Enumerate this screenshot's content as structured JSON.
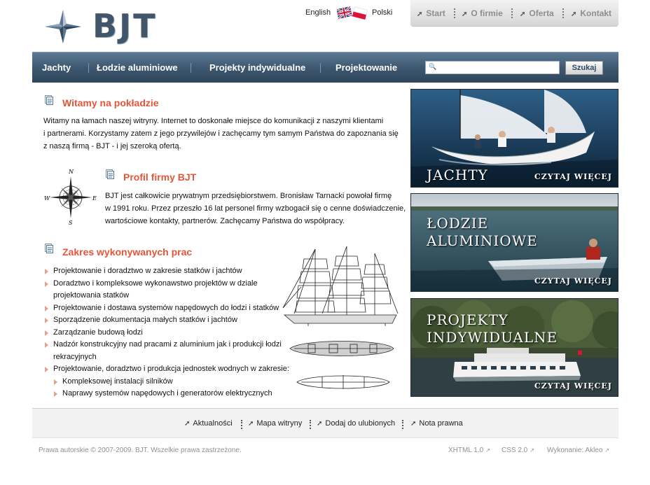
{
  "header": {
    "logo_text": "BJT",
    "lang_english": "English",
    "lang_polish": "Polski",
    "top_links": [
      "Start",
      "O firmie",
      "Oferta",
      "Kontakt"
    ]
  },
  "mainnav": {
    "items": [
      "Jachty",
      "Łodzie aluminiowe",
      "Projekty indywidualne",
      "Projektowanie"
    ],
    "search_placeholder": "",
    "search_button": "Szukaj"
  },
  "welcome": {
    "heading": "Witamy na pokładzie",
    "lines": [
      "Witamy na łamach naszej witryny. Internet to doskonałe miejsce do komunikacji z naszymi klientami",
      "i partnerami. Korzystamy zatem z jego przywilejów i zachęcamy tym samym Państwa do zapoznania się",
      "z naszą firmą - BJT - i jej szeroką ofertą."
    ]
  },
  "profile": {
    "heading": "Profil firmy BJT",
    "compass_letters": [
      "N",
      "E",
      "S",
      "W"
    ],
    "lines": [
      "BJT jest całkowicie prywatnym przedsiębiorstwem. Bronisław Tarnacki powołał firmę",
      "w 1991 roku. Przez przeszło 16 lat personel firmy wzbogacił się o cenne doświadczenie,",
      "wartościowe kontakty, partnerów. Zachęcamy Państwa do współpracy."
    ]
  },
  "scope": {
    "heading": "Zakres wykonywanych prac",
    "items": [
      {
        "text": "Projektowanie i doradztwo w zakresie statków i jachtów",
        "sub": false
      },
      {
        "text": "Doradztwo i kompleksowe wykonawstwo projektów w dziale",
        "sub": false
      },
      {
        "text": "projektowania statków",
        "sub": false,
        "cont": true
      },
      {
        "text": "Projektowanie i dostawa systemów napędowych do łodzi i statków",
        "sub": false
      },
      {
        "text": "Sporządzenie dokumentacja małych statków i jachtów",
        "sub": false
      },
      {
        "text": "Zarządzanie budową łodzi",
        "sub": false
      },
      {
        "text": "Nadzór konstrukcyjny nad pracami z aluminium jak i produkcji łodzi",
        "sub": false
      },
      {
        "text": "rekracyjnych",
        "sub": false,
        "cont": true
      },
      {
        "text": "Projektowanie, doradztwo i produkcja jednostek wodnych w zakresie:",
        "sub": false
      },
      {
        "text": "Kompleksowej instalacji silników",
        "sub": true
      },
      {
        "text": "Naprawy systemów napędowych i generatorów elektrycznych",
        "sub": true
      }
    ]
  },
  "banners": [
    {
      "title_lines": [
        "JACHTY"
      ],
      "more": "CZYTAJ WIĘCEJ"
    },
    {
      "title_lines": [
        "ŁODZIE",
        "ALUMINIOWE"
      ],
      "more": "CZYTAJ WIĘCEJ"
    },
    {
      "title_lines": [
        "PROJEKTY",
        "INDYWIDUALNE"
      ],
      "more": "CZYTAJ WIĘCEJ"
    }
  ],
  "footer": {
    "links": [
      "Aktualności",
      "Mapa witryny",
      "Dodaj do ulubionych",
      "Nota prawna"
    ],
    "copyright": "Prawa autorskie © 2007-2009. BJT. Wszelkie prawa zastrzeżone.",
    "xhtml": "XHTML 1.0",
    "css": "CSS 2.0",
    "credit_label": "Wykonanie:",
    "credit_name": "Akleo"
  },
  "colors": {
    "accent": "#e6553a",
    "nav_bg": "#3e5870",
    "logo": "#41566b"
  }
}
